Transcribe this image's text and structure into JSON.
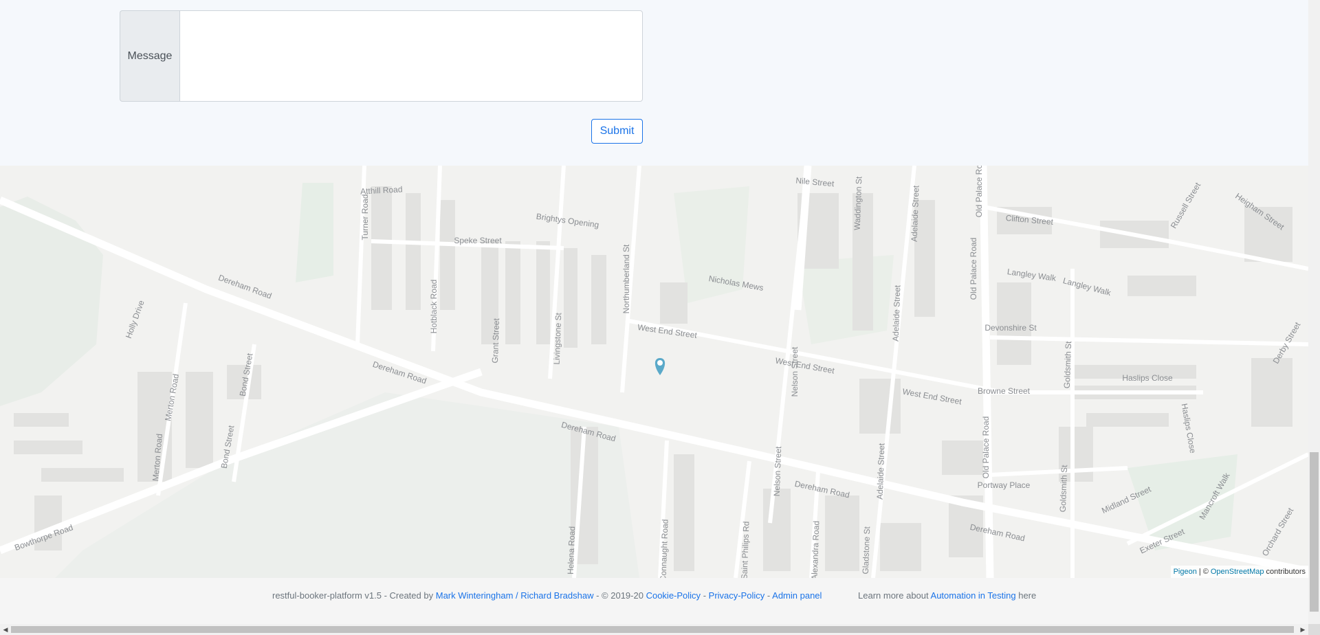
{
  "form": {
    "message_label": "Message",
    "message_value": "",
    "submit_label": "Submit"
  },
  "map": {
    "road_labels": [
      "Atthill Road",
      "Turner Road",
      "Hotblack Road",
      "Speke Street",
      "Brightys Opening",
      "Northumberland St",
      "Grant Street",
      "Livingstone St",
      "Dereham Road",
      "Dereham Road",
      "Dereham Road",
      "Dereham Road",
      "Dereham Road",
      "Holly Drive",
      "Merton Road",
      "Merton Road",
      "Bond Street",
      "Bond Street",
      "Bowthorpe Road",
      "West End Street",
      "West End Street",
      "West End Street",
      "Nicholas Mews",
      "Nelson Street",
      "Nelson Street",
      "Nile Street",
      "Waddington St",
      "Adelaide Street",
      "Adelaide Street",
      "Adelaide Street",
      "Old Palace Road",
      "Old Palace Road",
      "Old Palace Road",
      "Clifton Street",
      "Langley Walk",
      "Langley Walk",
      "Devonshire St",
      "Browne Street",
      "Haslips Close",
      "Haslips Close",
      "Goldsmith St",
      "Goldsmith St",
      "Portway Place",
      "Midland Street",
      "Mancroft Walk",
      "Exeter Street",
      "Orchard Street",
      "Derby Street",
      "Russell Street",
      "Heigham Street",
      "Helena Road",
      "Connaught Road",
      "Saint Philips Rd",
      "Alexandra Road",
      "Gladstone St"
    ],
    "attribution_pigeon": "Pigeon",
    "attribution_sep": "| ©",
    "attribution_osm": "OpenStreetMap",
    "attribution_rest": "contributors"
  },
  "footer": {
    "prefix": "restful-booker-platform v1.5 - Created by",
    "authors_link": "Mark Winteringham / Richard Bradshaw",
    "copyright": "- © 2019-20",
    "cookie_link": "Cookie-Policy",
    "dash1": "-",
    "privacy_link": "Privacy-Policy",
    "dash2": "-",
    "admin_link": "Admin panel",
    "learn_prefix": "Learn more about",
    "learn_link": "Automation in Testing",
    "learn_suffix": "here"
  },
  "colors": {
    "accent": "#1a73e8",
    "map_background": "#f2f2f0",
    "marker": "#5aa9c9"
  }
}
